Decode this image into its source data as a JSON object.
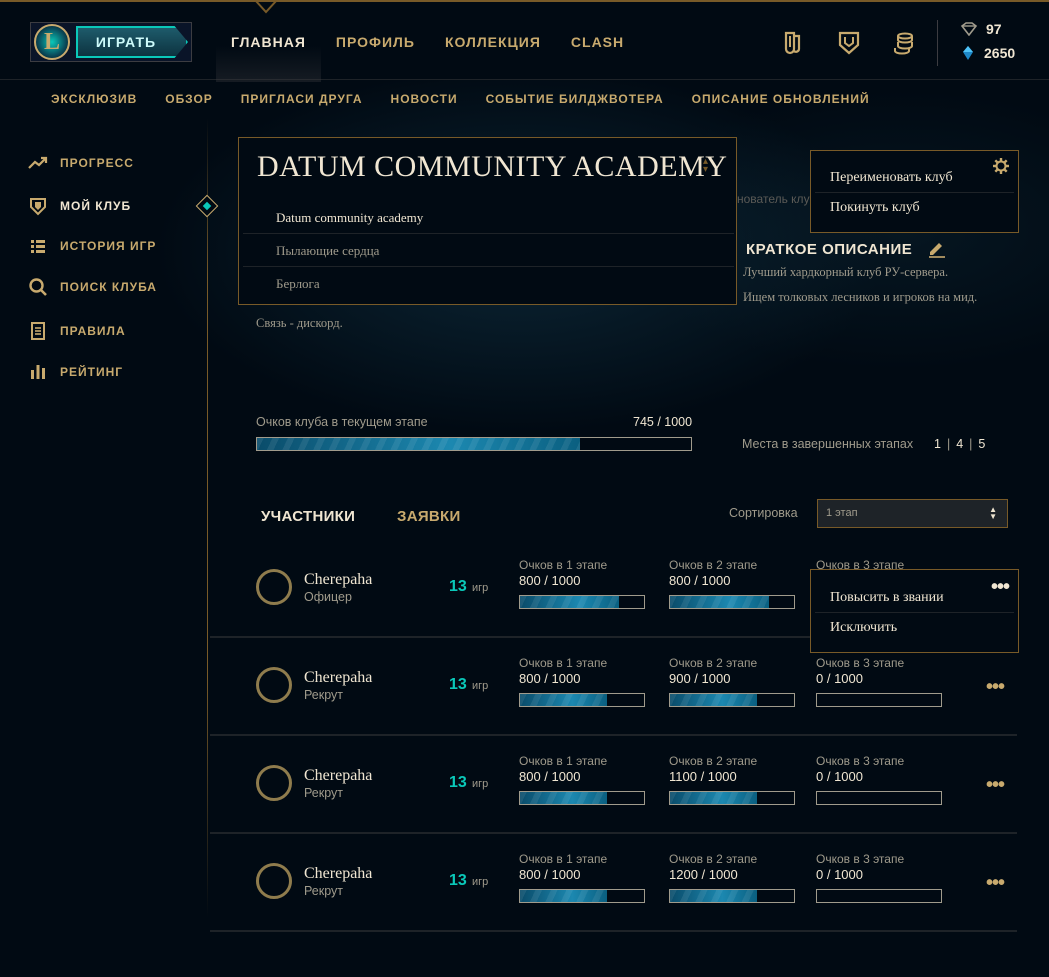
{
  "header": {
    "play_label": "ИГРАТЬ",
    "nav": [
      "ГЛАВНАЯ",
      "ПРОФИЛЬ",
      "КОЛЛЕКЦИЯ",
      "CLASH"
    ],
    "icons": [
      "tokens-icon",
      "shield-icon",
      "loot-icon"
    ],
    "currency": {
      "rp": "97",
      "be": "2650"
    }
  },
  "subnav": [
    "ЭКСКЛЮЗИВ",
    "ОБЗОР",
    "ПРИГЛАСИ ДРУГА",
    "НОВОСТИ",
    "СОБЫТИЕ БИЛДЖВОТЕРА",
    "ОПИСАНИЕ ОБНОВЛЕНИЙ"
  ],
  "sidebar": {
    "items": [
      "ПРОГРЕСС",
      "МОЙ КЛУБ",
      "ИСТОРИЯ ИГР",
      "ПОИСК КЛУБА",
      "ПРАВИЛА",
      "РЕЙТИНГ"
    ],
    "active_index": 1
  },
  "club": {
    "title": "DATUM COMMUNITY ACADEMY",
    "options": [
      "Datum community academy",
      "Пылающие сердца",
      "Берлога"
    ],
    "owner_hint_fragment": "нователь клу",
    "menu": [
      "Переименовать клуб",
      "Покинуть клуб"
    ],
    "description_title": "КРАТКОЕ ОПИСАНИЕ",
    "description_lines": [
      "Лучший хардкорный клуб РУ-сервера.",
      "Ищем толковых лесников и игроков на мид."
    ],
    "contact": "Связь - дискорд.",
    "points_label": "Очков клуба в текущем этапе",
    "points_value": "745 / 1000",
    "points_fraction": 0.745,
    "places_label": "Места в завершенных этапах",
    "places": [
      "1",
      "4",
      "5"
    ]
  },
  "members_section": {
    "tabs": [
      "УЧАСТНИКИ",
      "ЗАЯВКИ"
    ],
    "sort_label": "Сортировка",
    "sort_value": "1 этап",
    "games_unit": "игр",
    "member_menu": [
      "Повысить в звании",
      "Исключить"
    ],
    "members": [
      {
        "name": "Cherepaha",
        "rank": "Офицер",
        "games": "13",
        "stages": [
          {
            "label": "Очков в 1 этапе",
            "value": "800 / 1000",
            "fraction": 0.8
          },
          {
            "label": "Очков в 2 этапе",
            "value": "800 / 1000",
            "fraction": 0.8
          },
          {
            "label": "Очков в 3 этапе",
            "value": "",
            "fraction": 0
          }
        ]
      },
      {
        "name": "Cherepaha",
        "rank": "Рекрут",
        "games": "13",
        "stages": [
          {
            "label": "Очков в 1 этапе",
            "value": "800 / 1000",
            "fraction": 0.7
          },
          {
            "label": "Очков в 2 этапе",
            "value": "900 / 1000",
            "fraction": 0.7
          },
          {
            "label": "Очков в 3 этапе",
            "value": "0 / 1000",
            "fraction": 0
          }
        ]
      },
      {
        "name": "Cherepaha",
        "rank": "Рекрут",
        "games": "13",
        "stages": [
          {
            "label": "Очков в 1 этапе",
            "value": "800 / 1000",
            "fraction": 0.7
          },
          {
            "label": "Очков в 2 этапе",
            "value": "1100 / 1000",
            "fraction": 0.7
          },
          {
            "label": "Очков в 3 этапе",
            "value": "0 / 1000",
            "fraction": 0
          }
        ]
      },
      {
        "name": "Cherepaha",
        "rank": "Рекрут",
        "games": "13",
        "stages": [
          {
            "label": "Очков в 1 этапе",
            "value": "800 / 1000",
            "fraction": 0.7
          },
          {
            "label": "Очков в 2 этапе",
            "value": "1200 / 1000",
            "fraction": 0.7
          },
          {
            "label": "Очков в 3 этапе",
            "value": "0 / 1000",
            "fraction": 0
          }
        ]
      }
    ]
  },
  "colors": {
    "gold": "#c8aa6e",
    "gold_dark": "#785a28",
    "cyan": "#0ac8b9",
    "text": "#f0e6d2",
    "background": "#010a13"
  }
}
